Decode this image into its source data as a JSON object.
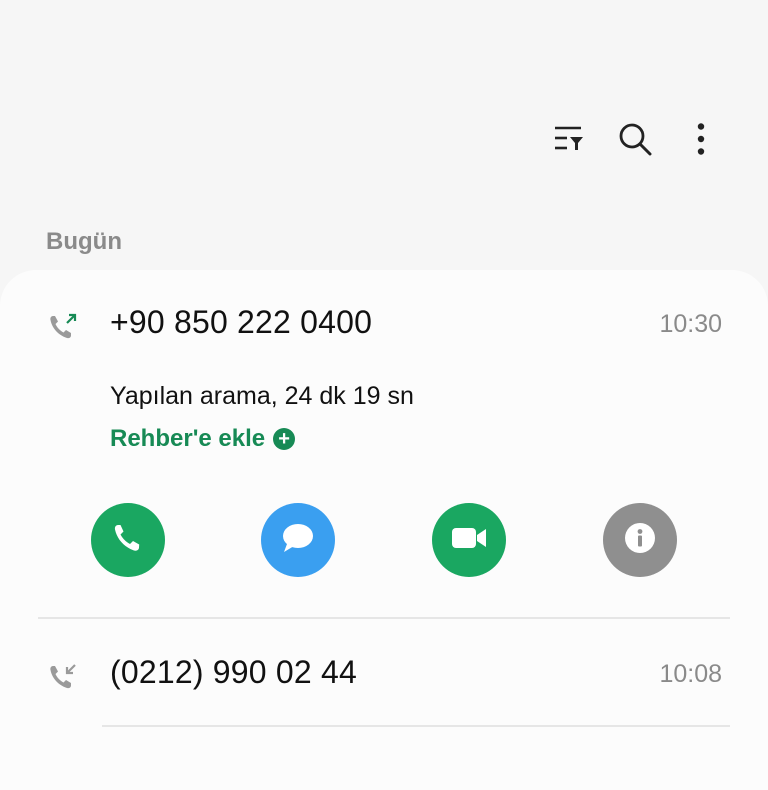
{
  "toolbar": {
    "icons": [
      "filter-icon",
      "search-icon",
      "more-options-icon"
    ]
  },
  "section": {
    "title": "Bugün"
  },
  "calls": [
    {
      "number": "+90 850 222 0400",
      "time": "10:30",
      "direction_icon": "outgoing-call-icon",
      "detail": "Yapılan arama, 24 dk 19 sn",
      "add_contact_label": "Rehber'e ekle",
      "actions": [
        "call-icon",
        "message-icon",
        "video-call-icon",
        "info-icon"
      ]
    },
    {
      "number": "(0212) 990 02 44",
      "time": "10:08",
      "direction_icon": "incoming-call-icon"
    }
  ],
  "colors": {
    "accent_green": "#178a55",
    "call_green": "#1aa761",
    "message_blue": "#3a9ff0",
    "info_gray": "#8f8f8f",
    "background": "#f6f6f6",
    "card": "#fcfcfc"
  }
}
